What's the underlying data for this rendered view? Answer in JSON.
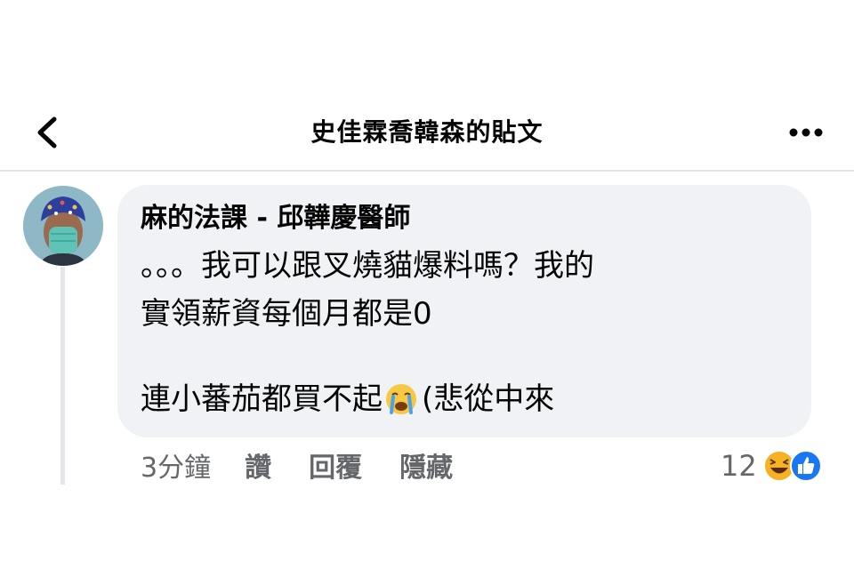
{
  "header": {
    "title": "史佳霖喬韓森的貼文"
  },
  "comment": {
    "author": "麻的法課 - 邱韡慶醫師",
    "lines": [
      "。。。我可以跟叉燒貓爆料嗎？我的",
      "實領薪資每個月都是0"
    ],
    "last_line_before_emoji": "連小蕃茄都買不起",
    "last_line_after_emoji": "(悲從中來",
    "inline_emoji": "crying-face-icon"
  },
  "actions": {
    "time": "3分鐘",
    "like": "讚",
    "reply": "回覆",
    "hide": "隱藏"
  },
  "reactions": {
    "count": "12",
    "icons": [
      "haha-reaction-icon",
      "like-reaction-icon"
    ],
    "like_color": "#1877f2",
    "haha_color": "#f7b125"
  }
}
